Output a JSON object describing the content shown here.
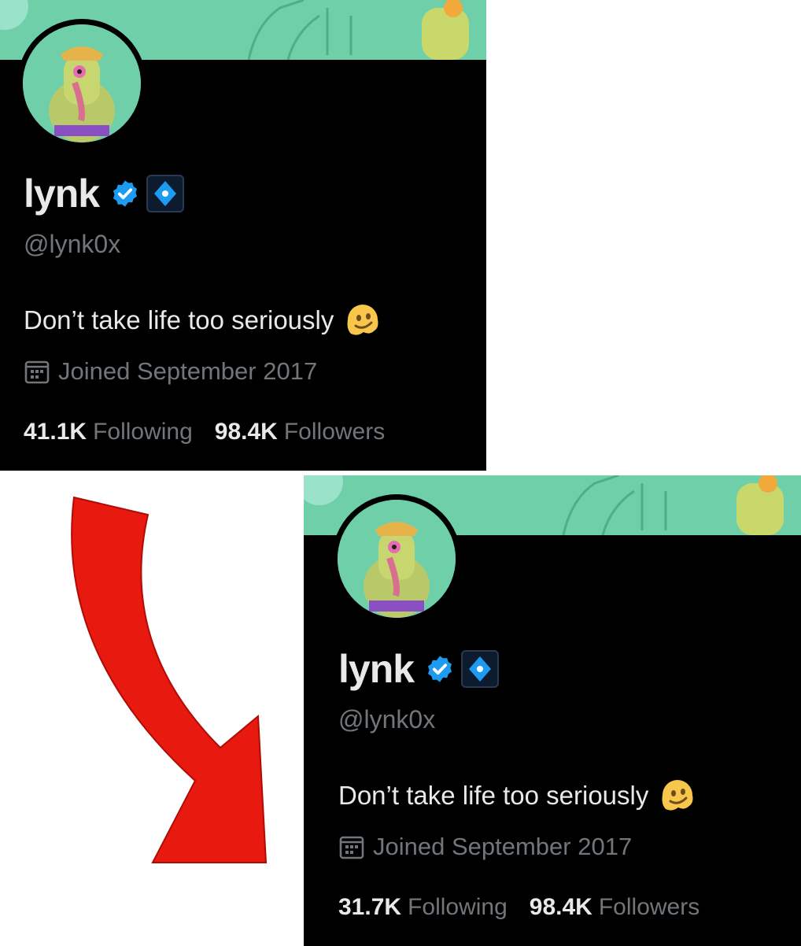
{
  "before": {
    "display_name": "lynk",
    "handle": "@lynk0x",
    "bio": "Don’t take life too seriously",
    "joined": "Joined September 2017",
    "following_count": "41.1K",
    "following_label": "Following",
    "followers_count": "98.4K",
    "followers_label": "Followers"
  },
  "after": {
    "display_name": "lynk",
    "handle": "@lynk0x",
    "bio": "Don’t take life too seriously",
    "joined": "Joined September 2017",
    "following_count": "31.7K",
    "following_label": "Following",
    "followers_count": "98.4K",
    "followers_label": "Followers"
  },
  "colors": {
    "background": "#000000",
    "banner": "#6fcfa8",
    "text_primary": "#e7e9ea",
    "text_secondary": "#71767b",
    "verified_blue": "#1d9bf0",
    "arrow_red": "#e8190f"
  },
  "icons": [
    "verified-badge-icon",
    "affiliate-diamond-icon",
    "melting-face-emoji",
    "calendar-icon",
    "red-curved-arrow"
  ]
}
